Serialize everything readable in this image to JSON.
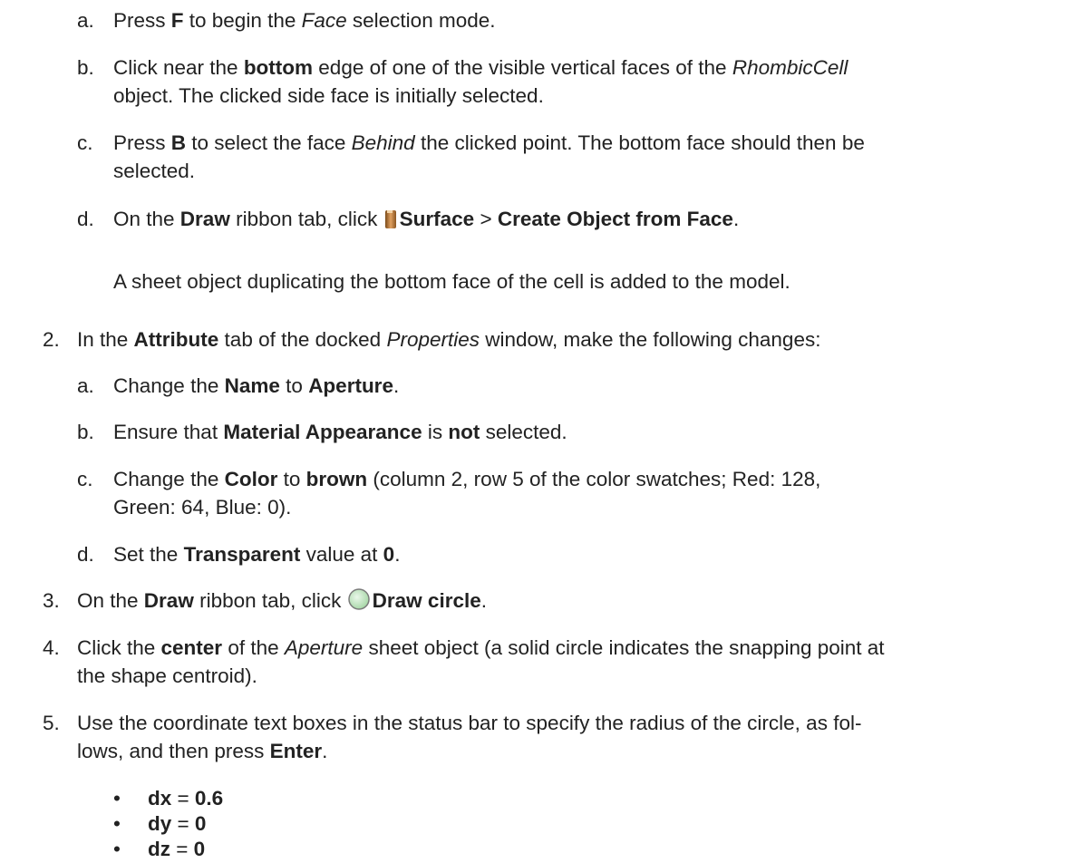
{
  "step1": {
    "a": {
      "marker": "a.",
      "t1": "Press ",
      "b1": "F",
      "t2": " to begin the ",
      "i1": "Face",
      "t3": " selection mode."
    },
    "b": {
      "marker": "b.",
      "t1": "Click near the ",
      "b1": "bottom",
      "t2": " edge of one of the visible vertical faces of the ",
      "i1": "RhombicCell",
      "t3": "object. The clicked side face is initially selected."
    },
    "c": {
      "marker": "c.",
      "t1": "Press ",
      "b1": "B",
      "t2": " to select the face ",
      "i1": "Behind",
      "t3": " the clicked point. The bottom face should then be",
      "t4": "selected."
    },
    "d": {
      "marker": "d.",
      "t1": "On the ",
      "b1": "Draw",
      "t2": " ribbon tab, click ",
      "b2": "Surface",
      "t3": " > ",
      "b3": "Create Object from Face",
      "t4": "."
    },
    "result": "A sheet object duplicating the bottom face of the cell is added to the model.",
    "icon": "surface-icon"
  },
  "step2": {
    "marker": "2.",
    "t1": "In the ",
    "b1": "Attribute",
    "t2": " tab of the docked ",
    "i1": "Properties",
    "t3": " window, make the following changes:",
    "a": {
      "marker": "a.",
      "t1": "Change the ",
      "b1": "Name",
      "t2": " to ",
      "b2": "Aperture",
      "t3": "."
    },
    "b": {
      "marker": "b.",
      "t1": "Ensure that ",
      "b1": "Material Appearance",
      "t2": " is ",
      "b2": "not",
      "t3": " selected."
    },
    "c": {
      "marker": "c.",
      "t1": "Change the ",
      "b1": "Color",
      "t2": " to ",
      "b2": "brown",
      "t3": " (column 2, row 5 of the color swatches; Red: 128,",
      "t4": "Green: 64, Blue: 0)."
    },
    "d": {
      "marker": "d.",
      "t1": "Set the ",
      "b1": "Transparent",
      "t2": " value at ",
      "b2": "0",
      "t3": "."
    }
  },
  "step3": {
    "marker": "3.",
    "t1": "On the ",
    "b1": "Draw",
    "t2": " ribbon tab, click ",
    "b2": "Draw circle",
    "t3": ".",
    "icon": "draw-circle-icon"
  },
  "step4": {
    "marker": "4.",
    "t1": "Click the ",
    "b1": "center",
    "t2": " of the ",
    "i1": "Aperture",
    "t3": " sheet object (a solid circle indicates the snapping point at",
    "t4": "the shape centroid)."
  },
  "step5": {
    "marker": "5.",
    "t1": "Use the coordinate text boxes in the status bar to specify the radius of the circle, as fol-",
    "t2": "lows, and then press ",
    "b1": "Enter",
    "t3": ".",
    "bullets": [
      {
        "bullet": "•",
        "label": "dx",
        "eq": " = ",
        "value": "0.6"
      },
      {
        "bullet": "•",
        "label": "dy",
        "eq": " = ",
        "value": "0"
      },
      {
        "bullet": "•",
        "label": "dz",
        "eq": " = ",
        "value": "0"
      }
    ]
  },
  "colors": {
    "text": "#222222",
    "surface_icon": "#b8762f",
    "circle_icon": "#bfe3bf"
  }
}
